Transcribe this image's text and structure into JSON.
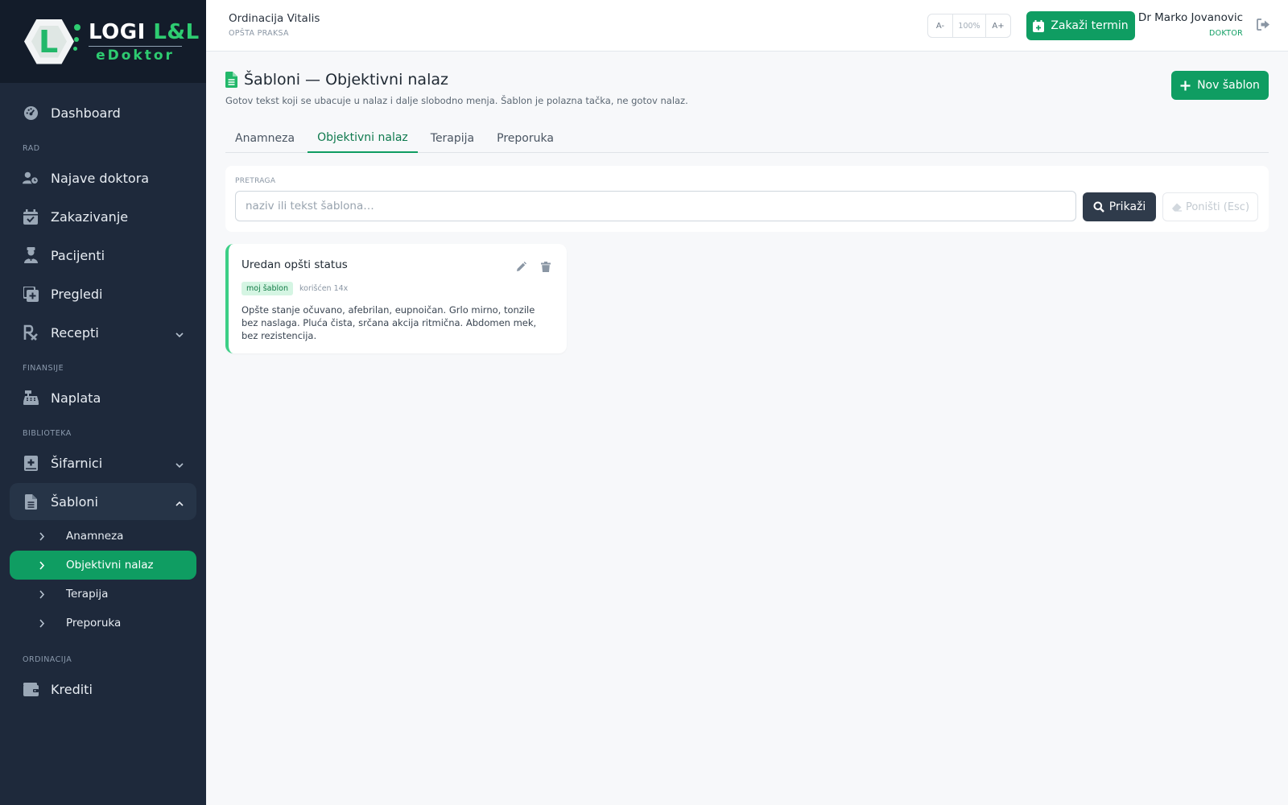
{
  "brand": {
    "logo_letter": "L",
    "name_main": "LOGI",
    "name_accent": "L&L",
    "product": "eDoktor"
  },
  "sidebar": {
    "dashboard": "Dashboard",
    "section_rad": "RAD",
    "najave": "Najave doktora",
    "zakazivanje": "Zakazivanje",
    "pacijenti": "Pacijenti",
    "pregledi": "Pregledi",
    "recepti": "Recepti",
    "section_finansije": "FINANSIJE",
    "naplata": "Naplata",
    "section_biblioteka": "BIBLIOTEKA",
    "sifarnici": "Šifarnici",
    "sabloni": "Šabloni",
    "sub_items": [
      "Anamneza",
      "Objektivni nalaz",
      "Terapija",
      "Preporuka"
    ],
    "section_ordinacija": "ORDINACIJA",
    "krediti": "Krediti"
  },
  "topbar": {
    "clinic_name": "Ordinacija Vitalis",
    "clinic_type": "OPŠTA PRAKSA",
    "zoom_minus": "A-",
    "zoom_value": "100%",
    "zoom_plus": "A+",
    "schedule_button": "Zakaži termin",
    "user_name": "Dr Marko Jovanovic",
    "user_role": "DOKTOR"
  },
  "page": {
    "title": "Šabloni — Objektivni nalaz",
    "subtitle": "Gotov tekst koji se ubacuje u nalaz i dalje slobodno menja. Šablon je polazna tačka, ne gotov nalaz.",
    "new_button": "Nov šablon",
    "tabs": [
      "Anamneza",
      "Objektivni nalaz",
      "Terapija",
      "Preporuka"
    ],
    "active_tab": "Objektivni nalaz"
  },
  "search": {
    "label": "PRETRAGA",
    "placeholder": "naziv ili tekst šablona…",
    "value": "",
    "show_button": "Prikaži",
    "clear_button": "Poništi (Esc)"
  },
  "templates": [
    {
      "title": "Uredan opšti status",
      "badge": "moj šablon",
      "usage": "korišćen 14x",
      "text": "Opšte stanje očuvano, afebrilan, eupnoičan. Grlo mirno, tonzile bez naslaga. Pluća čista, srčana akcija ritmična. Abdomen mek, bez rezistencija."
    }
  ],
  "colors": {
    "primary": "#0f9d62",
    "sidebar": "#1e293b",
    "brand_bg": "#131c2a",
    "accent": "#2ecc71",
    "dark_button": "#2f3b4b"
  }
}
